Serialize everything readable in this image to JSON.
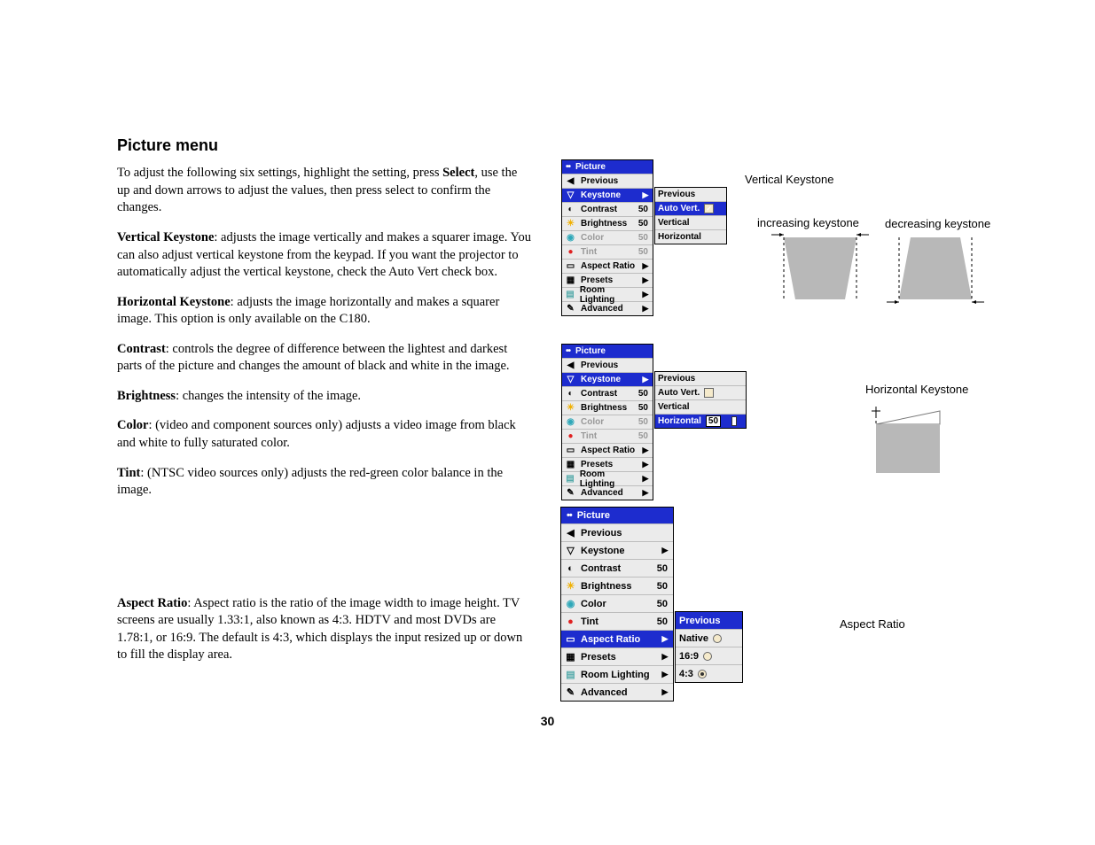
{
  "heading": "Picture menu",
  "paragraphs": {
    "intro_a": "To adjust the following six settings, highlight the setting, press ",
    "intro_b": "Select",
    "intro_c": ", use the up and down arrows to adjust the values, then press select to confirm the changes.",
    "vk_label": "Vertical Keystone",
    "vk_text": ": adjusts the image vertically and makes a squarer image. You can also adjust vertical keystone from the keypad. If you want the projector to automatically adjust the vertical keystone, check the Auto Vert check box.",
    "hk_label": "Horizontal Keystone",
    "hk_text": ": adjusts the image horizontally and makes a squarer image. This option is only available on the C180.",
    "ct_label": "Contrast",
    "ct_text": ": controls the degree of difference between the lightest and darkest parts of the picture and changes the amount of black and white in the image.",
    "br_label": "Brightness",
    "br_text": ": changes the intensity of the image.",
    "co_label": "Color",
    "co_text": ": (video and component sources only) adjusts a video image from black and white to fully saturated color.",
    "ti_label": "Tint",
    "ti_text": ": (NTSC video sources only) adjusts the red-green color balance in the image.",
    "ar_label": "Aspect Ratio",
    "ar_text": ": Aspect ratio is the ratio of the image width to image height. TV screens are usually 1.33:1, also known as 4:3. HDTV and most DVDs are 1.78:1, or 16:9. The default is 4:3, which displays the input resized up or down to fill the display area."
  },
  "page_number": "30",
  "captions": {
    "v_key": "Vertical Keystone",
    "h_key": "Horizontal Keystone",
    "inc": "increasing keystone",
    "dec": "decreasing keystone",
    "aspect": "Aspect Ratio"
  },
  "menu_title": "Picture",
  "items": {
    "previous": "Previous",
    "keystone": "Keystone",
    "contrast": "Contrast",
    "brightness": "Brightness",
    "color": "Color",
    "tint": "Tint",
    "aspect": "Aspect Ratio",
    "presets": "Presets",
    "room": "Room Lighting",
    "advanced": "Advanced"
  },
  "val50": "50",
  "sub_key": {
    "previous": "Previous",
    "auto": "Auto Vert.",
    "vertical": "Vertical",
    "horizontal": "Horizontal"
  },
  "sub_aspect": {
    "previous": "Previous",
    "native": "Native",
    "s169": "16:9",
    "s43": "4:3"
  }
}
